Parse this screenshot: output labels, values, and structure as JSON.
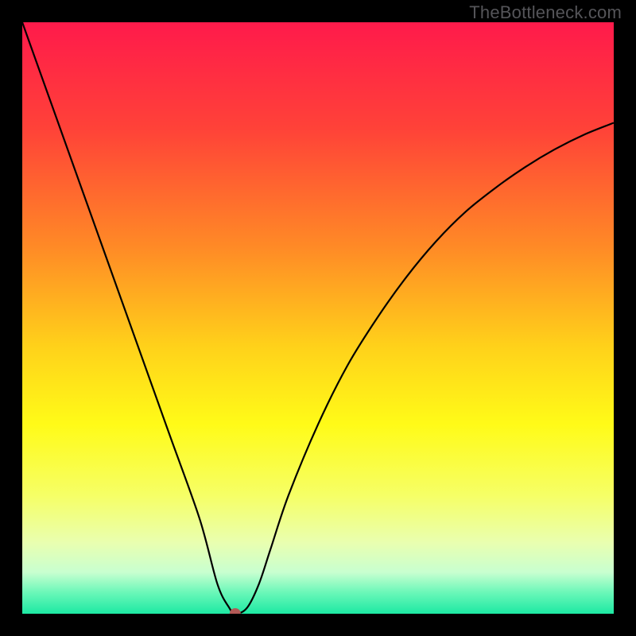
{
  "watermark": "TheBottleneck.com",
  "chart_data": {
    "type": "line",
    "title": "",
    "xlabel": "",
    "ylabel": "",
    "xlim": [
      0,
      100
    ],
    "ylim": [
      0,
      100
    ],
    "grid": false,
    "legend": false,
    "annotations": [],
    "series": [
      {
        "name": "curve",
        "x": [
          0,
          5,
          10,
          15,
          20,
          25,
          30,
          33,
          35,
          36,
          38,
          40,
          42,
          45,
          50,
          55,
          60,
          65,
          70,
          75,
          80,
          85,
          90,
          95,
          100
        ],
        "y": [
          100,
          86,
          72,
          58,
          44,
          30,
          16,
          5,
          1,
          0,
          1,
          5,
          11,
          20,
          32,
          42,
          50,
          57,
          63,
          68,
          72,
          75.5,
          78.5,
          81,
          83
        ],
        "color": "#000000"
      }
    ],
    "marker": {
      "x": 36,
      "y": 0,
      "color": "#b35a57",
      "radius": 7
    },
    "background_gradient": {
      "type": "vertical",
      "stops": [
        {
          "pos": 0.0,
          "color": "#ff1a4b"
        },
        {
          "pos": 0.18,
          "color": "#ff4238"
        },
        {
          "pos": 0.38,
          "color": "#ff8a26"
        },
        {
          "pos": 0.55,
          "color": "#ffd21a"
        },
        {
          "pos": 0.68,
          "color": "#fffb18"
        },
        {
          "pos": 0.8,
          "color": "#f6ff66"
        },
        {
          "pos": 0.88,
          "color": "#e9ffb0"
        },
        {
          "pos": 0.93,
          "color": "#c8ffd0"
        },
        {
          "pos": 0.965,
          "color": "#68f7b8"
        },
        {
          "pos": 1.0,
          "color": "#1de9a3"
        }
      ]
    }
  }
}
